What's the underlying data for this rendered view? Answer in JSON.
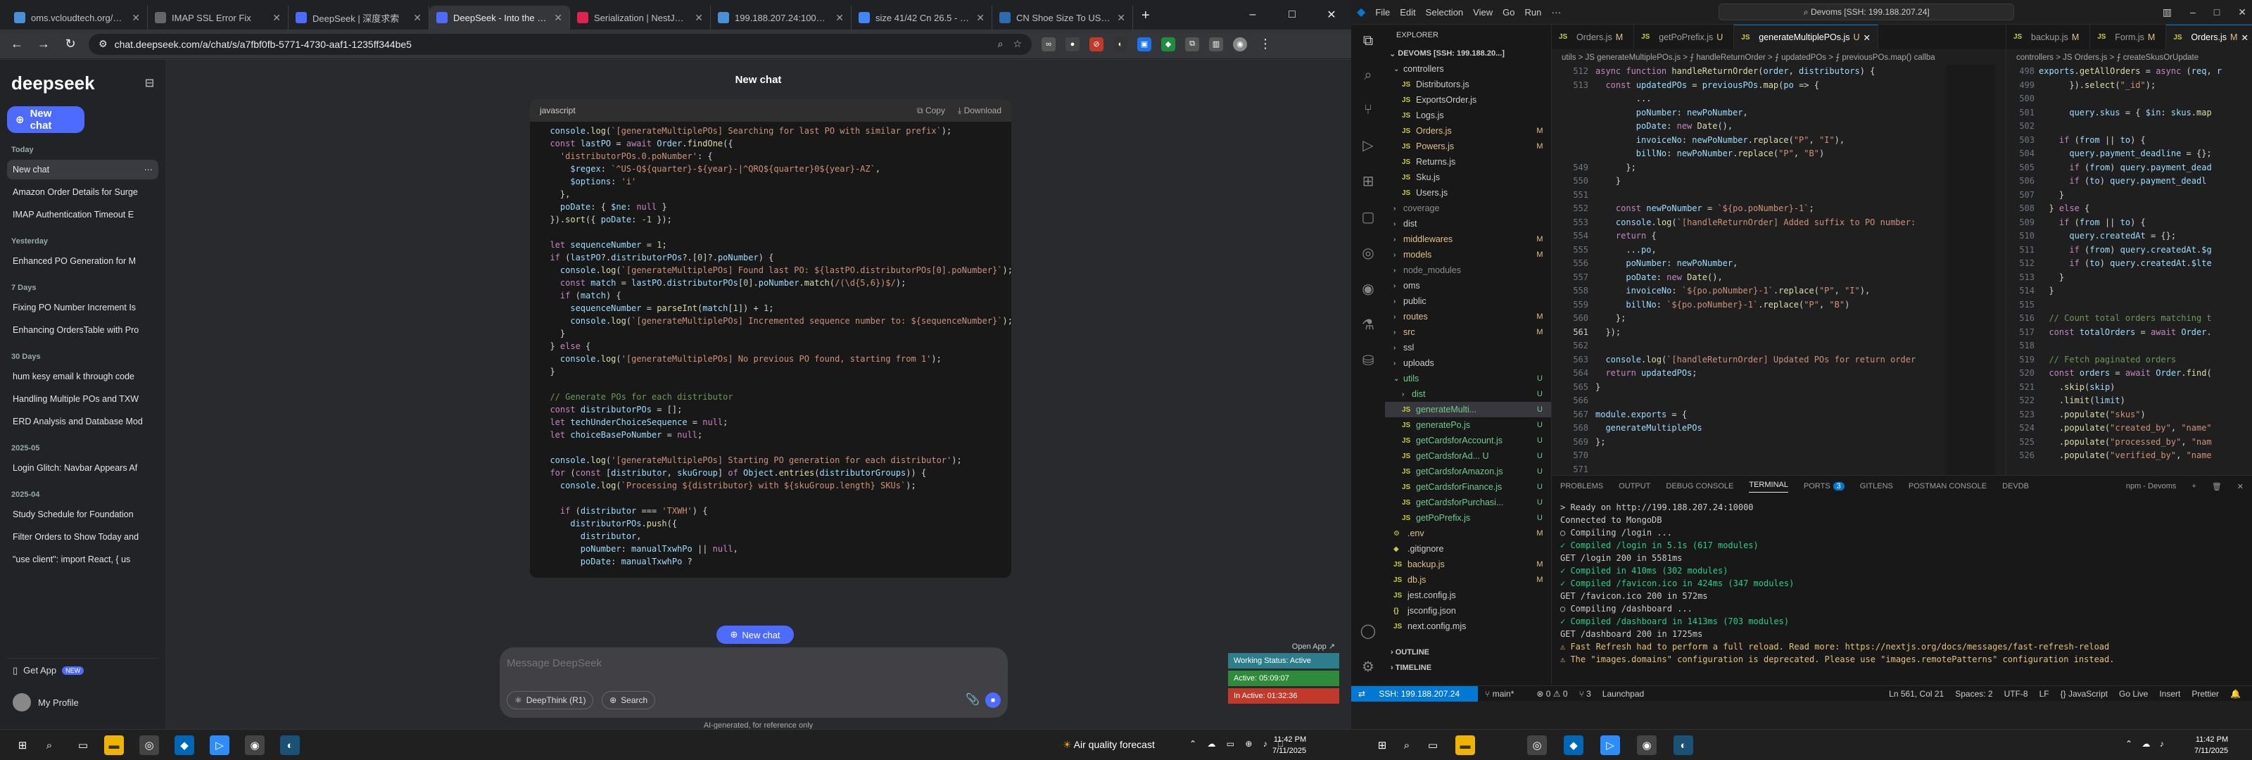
{
  "browser": {
    "tabs": [
      {
        "title": "oms.vcloudtech.org/das",
        "fav": "#4a90d9",
        "active": false
      },
      {
        "title": "IMAP SSL Error Fix",
        "fav": "#666666",
        "active": false
      },
      {
        "title": "DeepSeek | 深度求索",
        "fav": "#4d6bfe",
        "active": false
      },
      {
        "title": "DeepSeek - Into the Unk",
        "fav": "#4d6bfe",
        "active": true
      },
      {
        "title": "Serialization | NestJS - A",
        "fav": "#e0234e",
        "active": false
      },
      {
        "title": "199.188.207.24:10000/da",
        "fav": "#4a90d9",
        "active": false
      },
      {
        "title": "size 41/42 Cn 26.5 - Goo",
        "fav": "#4285f4",
        "active": false
      },
      {
        "title": "CN Shoe Size To US - A",
        "fav": "#2b6cb0",
        "active": false
      }
    ],
    "url": "chat.deepseek.com/a/chat/s/a7fbf0fb-5771-4730-aaf1-1235ff344be5"
  },
  "deepseek": {
    "logo": "deepseek",
    "new_chat": "New chat",
    "groups": [
      {
        "label": "Today",
        "items": [
          "New chat",
          "Amazon Order Details for Surge",
          "IMAP Authentication Timeout E"
        ]
      },
      {
        "label": "Yesterday",
        "items": [
          "Enhanced PO Generation for M"
        ]
      },
      {
        "label": "7 Days",
        "items": [
          "Fixing PO Number Increment Is",
          "Enhancing OrdersTable with Pro"
        ]
      },
      {
        "label": "30 Days",
        "items": [
          "hum kesy email k through code",
          "Handling Multiple POs and TXW",
          "ERD Analysis and Database Mod"
        ]
      },
      {
        "label": "2025-05",
        "items": [
          "Login Glitch: Navbar Appears Af"
        ]
      },
      {
        "label": "2025-04",
        "items": [
          "Study Schedule for Foundation",
          "Filter Orders to Show Today and",
          "\"use client\": import React, { us"
        ]
      }
    ],
    "get_app": "Get App",
    "new_badge": "NEW",
    "profile": "My Profile",
    "chat_title": "New chat",
    "code_lang": "javascript",
    "copy": "Copy",
    "download": "Download",
    "new_chat_float": "New chat",
    "input_placeholder": "Message DeepSeek",
    "deepthink": "DeepThink (R1)",
    "search": "Search",
    "disclaimer": "AI-generated, for reference only"
  },
  "widget": {
    "open_app": "Open App ↗",
    "rows": [
      {
        "text": "Working Status: Active",
        "color": "#2e7d8c"
      },
      {
        "text": "Active: 05:09:07",
        "color": "#2e8b3a"
      },
      {
        "text": "In Active: 01:32:36",
        "color": "#c0392b"
      }
    ]
  },
  "vscode": {
    "menu": [
      "File",
      "Edit",
      "Selection",
      "View",
      "Go",
      "Run"
    ],
    "search": "Devoms [SSH: 199.188.207.24]",
    "explorer_label": "EXPLORER",
    "root": "DEVOMS [SSH: 199.188.20...]",
    "files": [
      {
        "name": "controllers",
        "type": "folder",
        "open": true,
        "indent": 1,
        "status": ""
      },
      {
        "name": "Distributors.js",
        "type": "js",
        "indent": 2,
        "status": ""
      },
      {
        "name": "ExportsOrder.js",
        "type": "js",
        "indent": 2,
        "status": ""
      },
      {
        "name": "Logs.js",
        "type": "js",
        "indent": 2,
        "status": ""
      },
      {
        "name": "Orders.js",
        "type": "js",
        "indent": 2,
        "status": "M"
      },
      {
        "name": "Powers.js",
        "type": "js",
        "indent": 2,
        "status": "M"
      },
      {
        "name": "Returns.js",
        "type": "js",
        "indent": 2,
        "status": ""
      },
      {
        "name": "Sku.js",
        "type": "js",
        "indent": 2,
        "status": ""
      },
      {
        "name": "Users.js",
        "type": "js",
        "indent": 2,
        "status": ""
      },
      {
        "name": "coverage",
        "type": "folder",
        "open": false,
        "indent": 1,
        "status": "",
        "dim": true
      },
      {
        "name": "dist",
        "type": "folder",
        "open": false,
        "indent": 1,
        "status": ""
      },
      {
        "name": "middlewares",
        "type": "folder",
        "open": false,
        "indent": 1,
        "status": "M"
      },
      {
        "name": "models",
        "type": "folder",
        "open": false,
        "indent": 1,
        "status": "M"
      },
      {
        "name": "node_modules",
        "type": "folder",
        "open": false,
        "indent": 1,
        "status": "",
        "dim": true
      },
      {
        "name": "oms",
        "type": "folder",
        "open": false,
        "indent": 1,
        "status": ""
      },
      {
        "name": "public",
        "type": "folder",
        "open": false,
        "indent": 1,
        "status": ""
      },
      {
        "name": "routes",
        "type": "folder",
        "open": false,
        "indent": 1,
        "status": "M"
      },
      {
        "name": "src",
        "type": "folder",
        "open": false,
        "indent": 1,
        "status": "M"
      },
      {
        "name": "ssl",
        "type": "folder",
        "open": false,
        "indent": 1,
        "status": ""
      },
      {
        "name": "uploads",
        "type": "folder",
        "open": false,
        "indent": 1,
        "status": ""
      },
      {
        "name": "utils",
        "type": "folder",
        "open": true,
        "indent": 1,
        "status": "U"
      },
      {
        "name": "dist",
        "type": "folder",
        "open": false,
        "indent": 2,
        "status": "U"
      },
      {
        "name": "generateMulti...",
        "type": "js",
        "indent": 2,
        "status": "U",
        "sel": true
      },
      {
        "name": "generatePo.js",
        "type": "js",
        "indent": 2,
        "status": "U"
      },
      {
        "name": "getCardsforAccount.js",
        "type": "js",
        "indent": 2,
        "status": "U"
      },
      {
        "name": "getCardsforAd... U",
        "type": "js",
        "indent": 2,
        "status": "U"
      },
      {
        "name": "getCardsforAmazon.js",
        "type": "js",
        "indent": 2,
        "status": "U"
      },
      {
        "name": "getCardsforFinance.js",
        "type": "js",
        "indent": 2,
        "status": "U"
      },
      {
        "name": "getCardsforPurchasi...",
        "type": "js",
        "indent": 2,
        "status": "U"
      },
      {
        "name": "getPoPrefix.js",
        "type": "js",
        "indent": 2,
        "status": "U"
      },
      {
        "name": ".env",
        "type": "env",
        "indent": 1,
        "status": "M"
      },
      {
        "name": ".gitignore",
        "type": "git",
        "indent": 1,
        "status": ""
      },
      {
        "name": "backup.js",
        "type": "js",
        "indent": 1,
        "status": "M"
      },
      {
        "name": "db.js",
        "type": "js",
        "indent": 1,
        "status": "M"
      },
      {
        "name": "jest.config.js",
        "type": "js",
        "indent": 1,
        "status": ""
      },
      {
        "name": "jsconfig.json",
        "type": "json",
        "indent": 1,
        "status": ""
      },
      {
        "name": "next.config.mjs",
        "type": "js",
        "indent": 1,
        "status": ""
      }
    ],
    "outline": "OUTLINE",
    "timeline": "TIMELINE",
    "left_tabs": [
      {
        "name": "Orders.js",
        "mod": "M",
        "active": false
      },
      {
        "name": "getPoPrefix.js",
        "mod": "U",
        "active": false
      },
      {
        "name": "generateMultiplePOs.js",
        "mod": "U",
        "active": true
      }
    ],
    "left_bc": "utils > JS generateMultiplePOs.js > ⨍ handleReturnOrder > ⨍ updatedPOs > ⨍ previousPOs.map() callba",
    "right_tabs": [
      {
        "name": "backup.js",
        "mod": "M",
        "active": false
      },
      {
        "name": "Form.js",
        "mod": "M",
        "active": false
      },
      {
        "name": "Orders.js",
        "mod": "M",
        "active": true
      }
    ],
    "right_bc": "controllers > JS Orders.js > ⨍ createSkusOrUpdate",
    "panel_tabs": [
      "PROBLEMS",
      "OUTPUT",
      "DEBUG CONSOLE",
      "TERMINAL",
      "PORTS",
      "GITLENS",
      "POSTMAN CONSOLE",
      "DEVDB"
    ],
    "ports_count": "3",
    "terminal_lines": [
      {
        "t": "> Ready on http://199.188.207.24:10000",
        "k": ""
      },
      {
        "t": "Connected to MongoDB",
        "k": ""
      },
      {
        "t": "○ Compiling /login ...",
        "k": ""
      },
      {
        "t": "✓ Compiled /login in 5.1s (617 modules)",
        "k": "ok"
      },
      {
        "t": "GET /login 200 in 5581ms",
        "k": ""
      },
      {
        "t": "✓ Compiled in 410ms (302 modules)",
        "k": "ok"
      },
      {
        "t": "✓ Compiled /favicon.ico in 424ms (347 modules)",
        "k": "ok"
      },
      {
        "t": "GET /favicon.ico 200 in 572ms",
        "k": ""
      },
      {
        "t": "○ Compiling /dashboard ...",
        "k": ""
      },
      {
        "t": "✓ Compiled /dashboard in 1413ms (703 modules)",
        "k": "ok"
      },
      {
        "t": "GET /dashboard 200 in 1725ms",
        "k": ""
      },
      {
        "t": "⚠ Fast Refresh had to perform a full reload. Read more: https://nextjs.org/docs/messages/fast-refresh-reload",
        "k": "warn"
      },
      {
        "t": "⚠ The \"images.domains\" configuration is deprecated. Please use \"images.remotePatterns\" configuration instead.",
        "k": "warn"
      }
    ],
    "terminal_name": "npm - Devoms",
    "status": {
      "remote": "SSH: 199.188.207.24",
      "branch": "main*",
      "errors": "⊗ 0 ⚠ 0",
      "ports": "⑂ 3",
      "launchpad": "Launchpad",
      "position": "Ln 561, Col 21",
      "spaces": "Spaces: 2",
      "encoding": "UTF-8",
      "eol": "LF",
      "lang": "{} JavaScript",
      "golive": "Go Live",
      "insert": "Insert",
      "prettier": "Prettier"
    }
  },
  "taskbar": {
    "weather": "Air quality forecast",
    "time": "11:42 PM",
    "date": "7/11/2025"
  }
}
